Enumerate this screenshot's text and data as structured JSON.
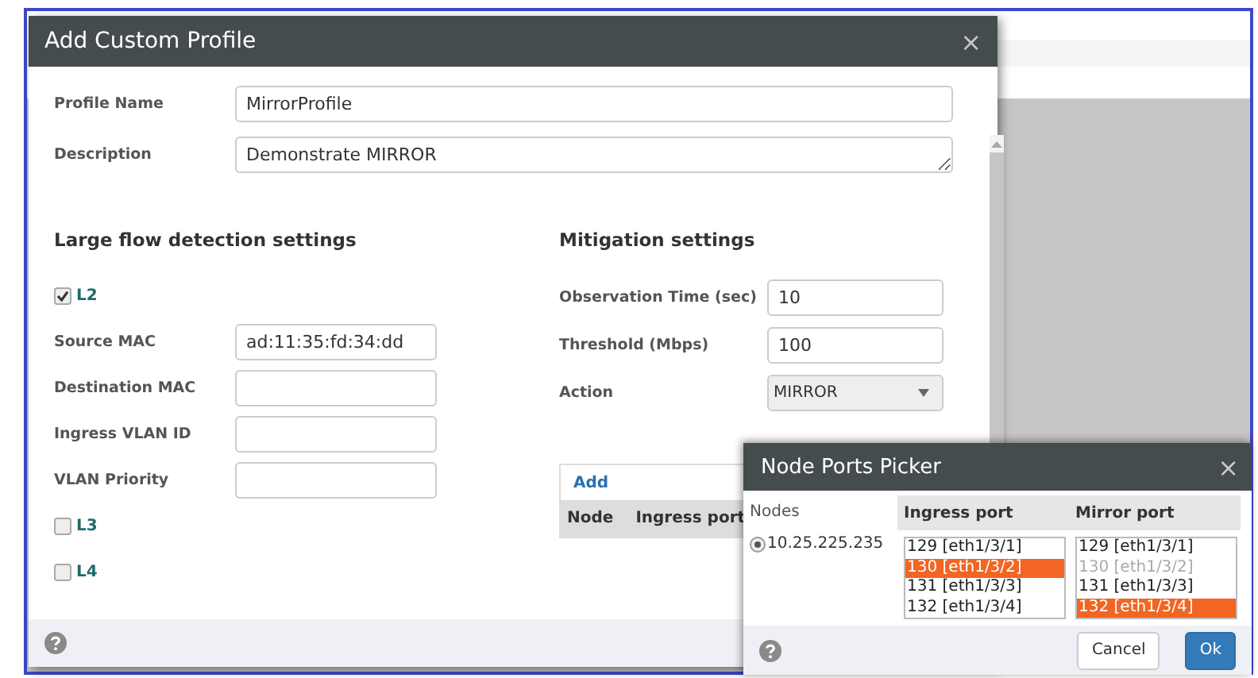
{
  "main_dialog": {
    "title": "Add Custom Profile",
    "close": "×",
    "profile_name": {
      "label": "Profile Name",
      "value": "MirrorProfile"
    },
    "description": {
      "label": "Description",
      "value": "Demonstrate MIRROR"
    },
    "detection": {
      "title": "Large flow detection settings",
      "items": [
        {
          "kind": "checkbox",
          "label": "L2",
          "checked": true
        },
        {
          "kind": "field",
          "label": "Source MAC",
          "value": "ad:11:35:fd:34:dd"
        },
        {
          "kind": "field",
          "label": "Destination MAC"
        },
        {
          "kind": "field",
          "label": "Ingress VLAN ID"
        },
        {
          "kind": "field",
          "label": "VLAN Priority"
        },
        {
          "kind": "checkbox",
          "label": "L3",
          "checked": false
        },
        {
          "kind": "checkbox",
          "label": "L4",
          "checked": false
        }
      ]
    },
    "mitigation": {
      "title": "Mitigation settings",
      "fields": [
        {
          "kind": "input",
          "label": "Observation Time (sec)",
          "value": "10"
        },
        {
          "kind": "input",
          "label": "Threshold (Mbps)",
          "value": "100"
        },
        {
          "kind": "select",
          "label": "Action",
          "value": "MIRROR"
        }
      ]
    },
    "table": {
      "add": "Add",
      "columns": [
        "Node",
        "Ingress port"
      ]
    }
  },
  "picker": {
    "title": "Node Ports Picker",
    "close": "×",
    "nodes_label": "Nodes",
    "nodes": [
      {
        "label": "10.25.225.235",
        "selected": true
      }
    ],
    "lists": [
      {
        "heading": "Ingress port",
        "options": [
          {
            "label": "129 [eth1/3/1]",
            "selected": false,
            "disabled": false
          },
          {
            "label": "130 [eth1/3/2]",
            "selected": true,
            "disabled": false
          },
          {
            "label": "131 [eth1/3/3]",
            "selected": false,
            "disabled": false
          },
          {
            "label": "132 [eth1/3/4]",
            "selected": false,
            "disabled": false
          }
        ]
      },
      {
        "heading": "Mirror port",
        "options": [
          {
            "label": "129 [eth1/3/1]",
            "selected": false,
            "disabled": false
          },
          {
            "label": "130 [eth1/3/2]",
            "selected": false,
            "disabled": true
          },
          {
            "label": "131 [eth1/3/3]",
            "selected": false,
            "disabled": false
          },
          {
            "label": "132 [eth1/3/4]",
            "selected": true,
            "disabled": false
          }
        ]
      }
    ],
    "buttons": [
      {
        "label": "Cancel",
        "kind": "default"
      },
      {
        "label": "Ok",
        "kind": "primary"
      }
    ]
  }
}
